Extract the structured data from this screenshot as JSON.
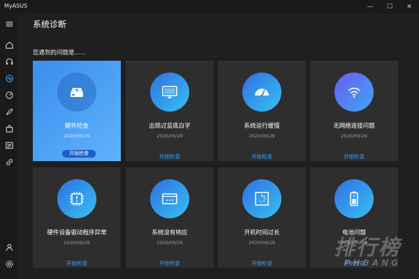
{
  "window": {
    "app_title": "MyASUS",
    "minimize": "—",
    "maximize": "☐",
    "close": "✕"
  },
  "sidebar": {
    "items": [
      {
        "icon": "menu-icon"
      },
      {
        "icon": "home-icon"
      },
      {
        "icon": "headset-icon"
      },
      {
        "icon": "diagnostics-icon"
      },
      {
        "icon": "speed-icon"
      },
      {
        "icon": "rocket-icon"
      },
      {
        "icon": "bag-icon"
      },
      {
        "icon": "news-icon"
      },
      {
        "icon": "link-icon"
      },
      {
        "icon": "user-icon"
      },
      {
        "icon": "settings-icon"
      }
    ]
  },
  "page": {
    "title": "系统诊断",
    "section_label": "您遇到的问题是......"
  },
  "cards": [
    {
      "title": "硬件检查",
      "date": "2020/09/29",
      "action": "开始检查",
      "icon": "hard-drive-icon",
      "active": true
    },
    {
      "title": "出现过蓝底白字",
      "date": "2020/09/29",
      "action": "开始检查",
      "icon": "monitor-icon"
    },
    {
      "title": "系统运行缓慢",
      "date": "2020/09/29",
      "action": "开始检查",
      "icon": "speedometer-icon"
    },
    {
      "title": "无网络连接问题",
      "date": "2020/09/29",
      "action": "开始检查",
      "icon": "wifi-icon"
    },
    {
      "title": "硬件设备驱动程序异常",
      "date": "2020/09/29",
      "action": "开始检查",
      "icon": "driver-chip-icon"
    },
    {
      "title": "系统没有响应",
      "date": "2020/09/29",
      "action": "开始检查",
      "icon": "dialog-window-icon"
    },
    {
      "title": "开机时间过长",
      "date": "2020/09/29",
      "action": "开始检查",
      "icon": "loading-icon"
    },
    {
      "title": "电池问题",
      "date": "2020/09/29",
      "action": "开始检查",
      "icon": "battery-icon"
    }
  ],
  "watermark": {
    "main": "排行榜",
    "sub": "PHBANG"
  },
  "colors": {
    "accent": "#3aa0ff",
    "active_card": "#4aa0f5",
    "card_bg": "#2e2e2e",
    "app_bg": "#1f1f1f"
  }
}
